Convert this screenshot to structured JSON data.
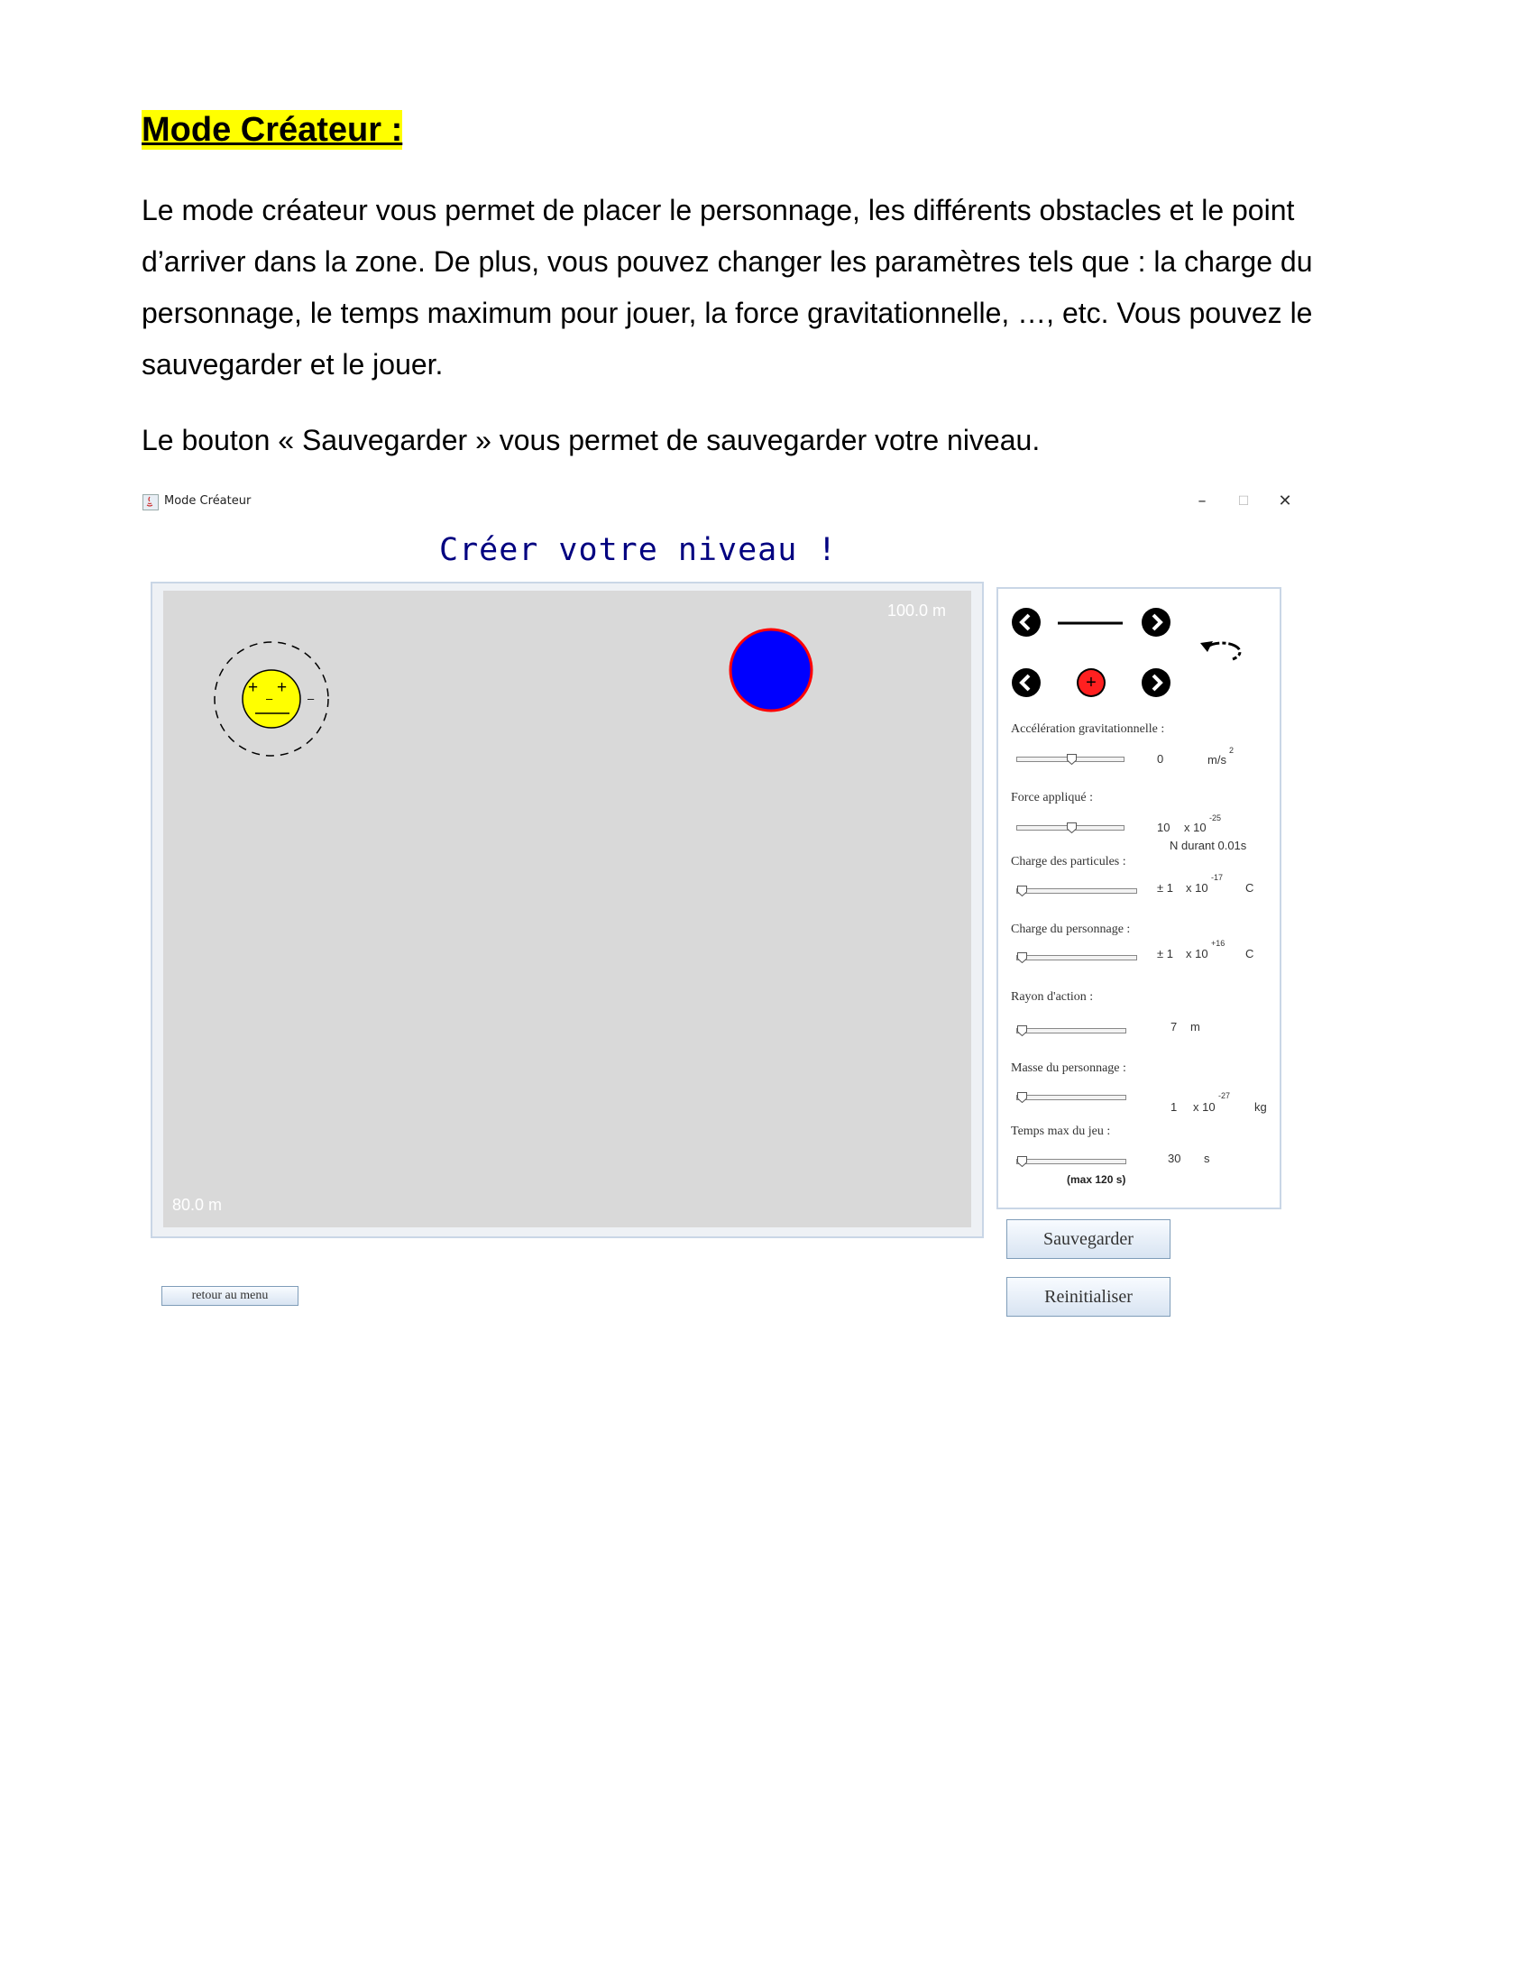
{
  "document": {
    "title": "Mode Créateur :",
    "paragraph1": "Le mode créateur vous permet de placer le personnage, les différents obstacles et le point d’arriver dans la zone. De plus, vous pouvez changer les paramètres tels que : la charge du personnage, le temps maximum pour jouer, la force gravitationnelle, …, etc. Vous pouvez le sauvegarder et le jouer.",
    "paragraph2": "Le bouton « Sauvegarder » vous permet de sauvegarder votre niveau."
  },
  "window": {
    "title": "Mode Créateur",
    "minimize": "–",
    "maximize": "☐",
    "close": "✕",
    "heading": "Créer votre niveau !"
  },
  "canvas": {
    "width_label": "100.0 m",
    "height_label": "80.0 m",
    "character_signs": [
      "+",
      "+",
      "–",
      "–"
    ],
    "colors": {
      "background": "#d9d9d9",
      "goal_fill": "#0000ff",
      "goal_border": "#ff0000",
      "character": "#ffff00"
    }
  },
  "panel": {
    "icons": [
      "chevron-left-icon",
      "line-obstacle-icon",
      "chevron-right-icon",
      "rotate-icon",
      "chevron-left-icon",
      "positive-charge-icon",
      "chevron-right-icon"
    ],
    "positive_sign": "+",
    "params": {
      "gravity": {
        "label": "Accélération gravitationnelle :",
        "value": "0",
        "unit": "m/s",
        "unit_exp": "2",
        "level": 0.5
      },
      "force": {
        "label": "Force appliqué :",
        "value": "10",
        "mult": "x 10",
        "exp": "-25",
        "note": "N durant 0.01s",
        "level": 0.5
      },
      "particle_charge": {
        "label": "Charge des particules :",
        "value": "± 1",
        "mult": "x 10",
        "exp": "-17",
        "unit": "C",
        "level": 0.0
      },
      "character_charge": {
        "label": "Charge du personnage :",
        "value": "± 1",
        "mult": "x 10",
        "exp": "+16",
        "unit": "C",
        "level": 0.0
      },
      "radius": {
        "label": "Rayon d'action :",
        "value": "7",
        "unit": "m",
        "level": 0.0
      },
      "mass": {
        "label": "Masse du personnage :",
        "value": "1",
        "mult": "x 10",
        "exp": "-27",
        "unit": "kg",
        "level": 0.0
      },
      "time": {
        "label": "Temps max du jeu :",
        "value": "30",
        "unit": "s",
        "note": "(max 120 s)",
        "level": 0.0
      }
    }
  },
  "buttons": {
    "save": "Sauvegarder",
    "reset": "Reinitialiser",
    "back": "retour au menu"
  }
}
